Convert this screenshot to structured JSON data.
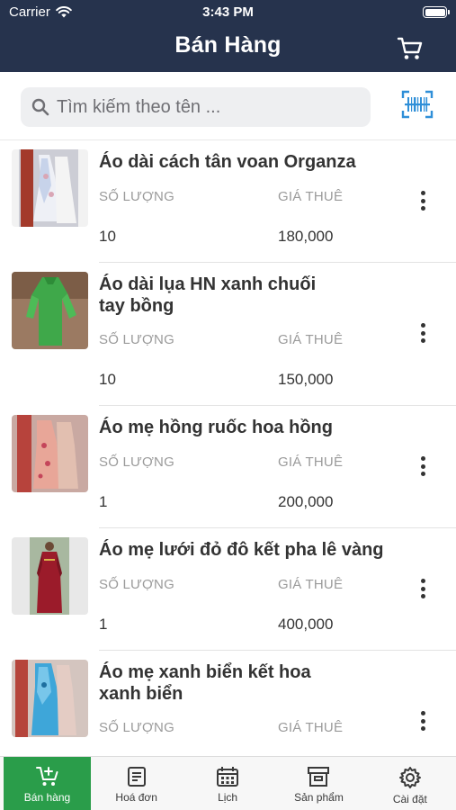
{
  "status_bar": {
    "carrier": "Carrier",
    "time": "3:43 PM"
  },
  "header": {
    "title": "Bán Hàng"
  },
  "search": {
    "placeholder": "Tìm kiếm theo tên ..."
  },
  "labels": {
    "quantity": "SỐ LƯỢNG",
    "price": "GIÁ THUÊ"
  },
  "products": [
    {
      "name": "Áo dài cách tân voan Organza",
      "quantity": "10",
      "price": "180,000"
    },
    {
      "name": "Áo dài lụa HN xanh chuối tay bồng",
      "quantity": "10",
      "price": "150,000"
    },
    {
      "name": "Áo mẹ hồng ruốc hoa hồng",
      "quantity": "1",
      "price": "200,000"
    },
    {
      "name": "Áo mẹ lưới đỏ đô kết pha lê vàng",
      "quantity": "1",
      "price": "400,000"
    },
    {
      "name": "Áo mẹ xanh biển kết hoa xanh biển",
      "quantity": "",
      "price": ""
    }
  ],
  "tabs": [
    {
      "label": "Bán hàng",
      "icon": "cart-plus-icon",
      "active": true
    },
    {
      "label": "Hoá đơn",
      "icon": "invoice-icon",
      "active": false
    },
    {
      "label": "Lịch",
      "icon": "calendar-icon",
      "active": false
    },
    {
      "label": "Sản phẩm",
      "icon": "archive-box-icon",
      "active": false
    },
    {
      "label": "Cài đặt",
      "icon": "gear-icon",
      "active": false
    }
  ],
  "colors": {
    "header_bg": "#26334d",
    "accent_green": "#2a9d4a",
    "barcode_blue": "#2f8fd8"
  }
}
